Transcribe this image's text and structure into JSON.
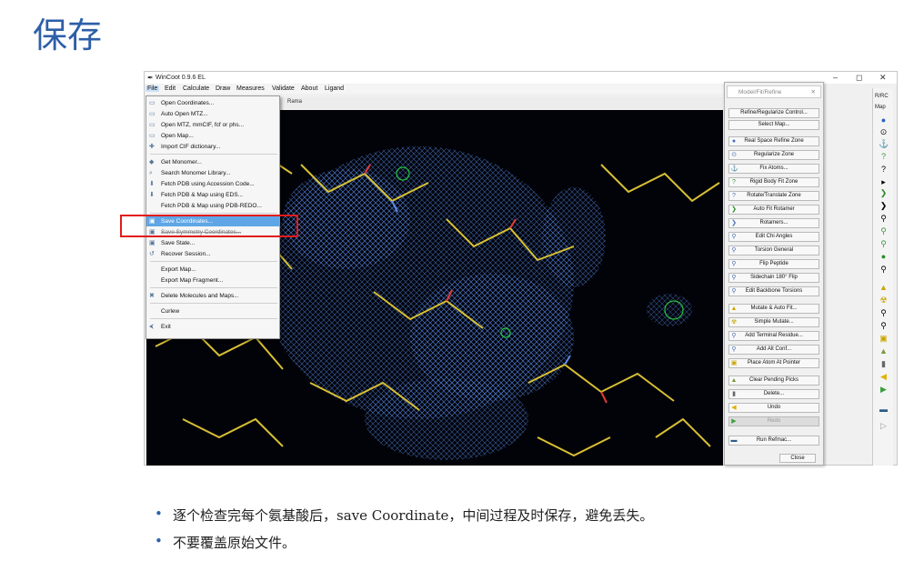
{
  "slide": {
    "title": "保存",
    "bullets": [
      "逐个检查完每个氨基酸后，save Coordinate，中间过程及时保存，避免丢失。",
      "不要覆盖原始文件。"
    ]
  },
  "window": {
    "title": "WinCoot 0.9.6 EL",
    "controls": [
      "–",
      "◻",
      "✕"
    ]
  },
  "menubar": {
    "items": [
      "File",
      "Edit",
      "Calculate",
      "Draw",
      "Measures",
      "Validate",
      "About",
      "Ligand"
    ]
  },
  "toolstrip": {
    "label": "Rama"
  },
  "file_menu": {
    "items": [
      {
        "label": "Open Coordinates...",
        "icon": "folder-icon"
      },
      {
        "label": "Auto Open MTZ...",
        "icon": "folder-icon"
      },
      {
        "label": "Open MTZ, mmCIF, fcf or phs...",
        "icon": "folder-icon"
      },
      {
        "label": "Open Map...",
        "icon": "folder-icon"
      },
      {
        "label": "Import CIF dictionary...",
        "icon": "import-icon"
      },
      {
        "label": "Get Monomer...",
        "icon": "monomer-icon"
      },
      {
        "label": "Search Monomer Library...",
        "icon": "search-icon"
      },
      {
        "label": "Fetch PDB using Accession Code...",
        "icon": "fetch-icon"
      },
      {
        "label": "Fetch PDB & Map using EDS...",
        "icon": "fetch-icon"
      },
      {
        "label": "Fetch PDB & Map using PDB-REDO...",
        "icon": ""
      },
      {
        "label": "Save Coordinates...",
        "icon": "save-icon"
      },
      {
        "label": "Save Symmetry Coordinates...",
        "icon": "save-icon"
      },
      {
        "label": "Save State...",
        "icon": "save-icon"
      },
      {
        "label": "Recover Session...",
        "icon": "recover-icon"
      },
      {
        "label": "Export Map...",
        "icon": ""
      },
      {
        "label": "Export Map Fragment...",
        "icon": ""
      },
      {
        "label": "Delete Molecules and Maps...",
        "icon": "delete-icon"
      },
      {
        "label": "Curlew",
        "icon": ""
      },
      {
        "label": "Exit",
        "icon": "exit-icon"
      }
    ]
  },
  "panel": {
    "title": "Model/Fit/Refine",
    "buttons": [
      {
        "label": "Refine/Regularize Control...",
        "icon": ""
      },
      {
        "label": "Select Map...",
        "icon": ""
      },
      {
        "label": "Real Space Refine Zone",
        "icon": "refine-icon"
      },
      {
        "label": "Regularize Zone",
        "icon": "regularize-icon"
      },
      {
        "label": "Fix Atoms...",
        "icon": "anchor-icon"
      },
      {
        "label": "Rigid Body Fit Zone",
        "icon": "rigid-body-icon"
      },
      {
        "label": "Rotate/Translate Zone",
        "icon": "rotate-icon"
      },
      {
        "label": "Auto Fit Rotamer",
        "icon": "rotamer-icon"
      },
      {
        "label": "Rotamers...",
        "icon": "rotamer-icon"
      },
      {
        "label": "Edit Chi Angles",
        "icon": "chi-icon"
      },
      {
        "label": "Torsion General",
        "icon": "torsion-icon"
      },
      {
        "label": "Flip Peptide",
        "icon": "flip-icon"
      },
      {
        "label": "Sidechain 180° Flip",
        "icon": "flip-icon"
      },
      {
        "label": "Edit Backbone Torsions",
        "icon": "backbone-icon"
      },
      {
        "label": "Mutate & Auto Fit...",
        "icon": "mutate-icon"
      },
      {
        "label": "Simple Mutate...",
        "icon": "mutate-icon"
      },
      {
        "label": "Add Terminal Residue...",
        "icon": "terminal-icon"
      },
      {
        "label": "Add Alt Conf...",
        "icon": "alt-conf-icon"
      },
      {
        "label": "Place Atom At Pointer",
        "icon": "place-atom-icon"
      },
      {
        "label": "Clear Pending Picks",
        "icon": "clear-icon"
      },
      {
        "label": "Delete...",
        "icon": "trash-icon"
      },
      {
        "label": "Undo",
        "icon": "undo-icon"
      },
      {
        "label": "Redo",
        "icon": "redo-icon"
      },
      {
        "label": "Run Refmac...",
        "icon": "refmac-icon"
      }
    ],
    "close_label": "Close"
  },
  "rightbar": {
    "top_label": "R/RC",
    "map_label": "Map"
  },
  "colors": {
    "title_blue": "#2e5fa8",
    "highlight": "#5ea6e6",
    "red_box": "#e21b1b",
    "mesh": "#4f7ed8",
    "stick_yellow": "#d8c034"
  }
}
